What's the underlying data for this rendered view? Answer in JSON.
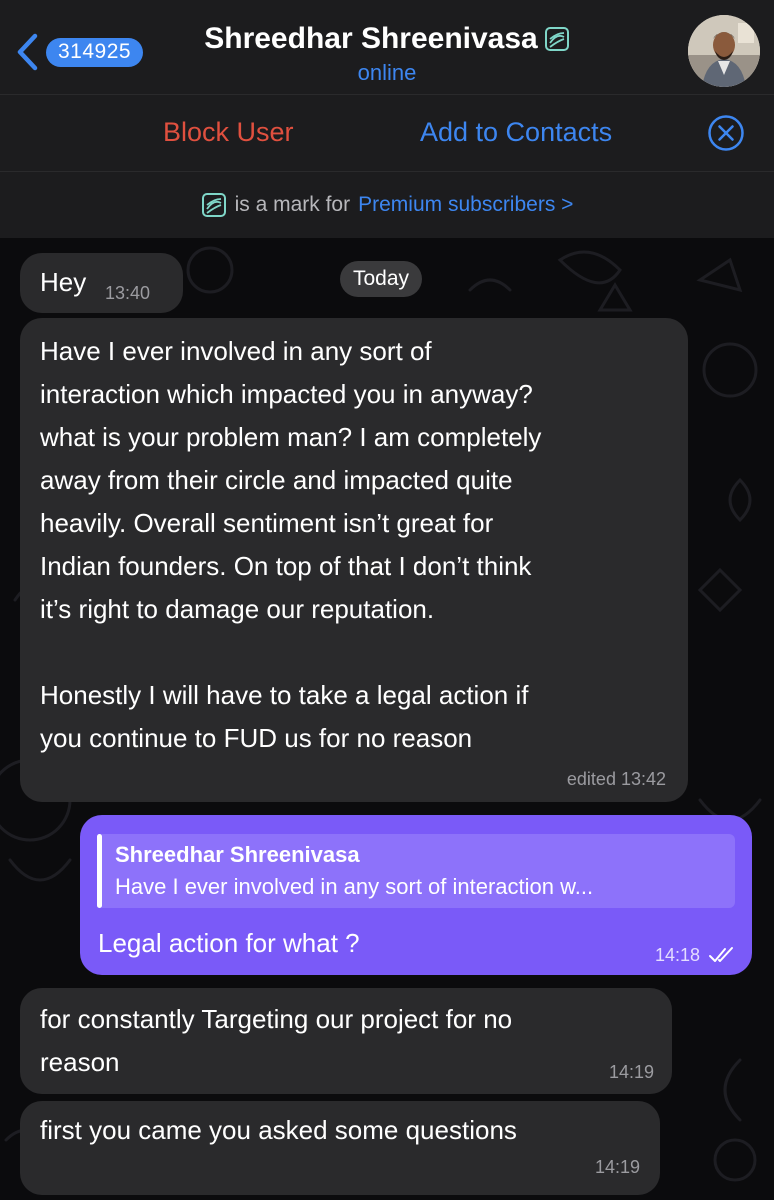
{
  "header": {
    "back_count": "314925",
    "name": "Shreedhar Shreenivasa",
    "status": "online"
  },
  "actions": {
    "block": "Block User",
    "add_contacts": "Add to Contacts"
  },
  "premium_notice": {
    "text": "is a mark for",
    "link": "Premium subscribers >"
  },
  "date_separator": "Today",
  "messages": [
    {
      "direction": "incoming",
      "text": "Hey",
      "time": "13:40"
    },
    {
      "direction": "incoming",
      "text": "Have I ever involved in any sort of\ninteraction which impacted you in anyway?\nwhat is your problem man? I am completely\naway from their circle and impacted quite\nheavily. Overall sentiment isn’t great for\nIndian founders. On top of that I don’t think\nit’s right to damage our reputation.\n\nHonestly I will have to take a legal action if\nyou continue to FUD us for no reason",
      "time": "edited 13:42"
    },
    {
      "direction": "outgoing",
      "reply_to": {
        "name": "Shreedhar Shreenivasa",
        "snippet": "Have I ever involved in any sort of interaction w..."
      },
      "text": "Legal action for what ?",
      "time": "14:18",
      "read": true
    },
    {
      "direction": "incoming",
      "text": "for constantly Targeting our project for no\nreason",
      "time": "14:19"
    },
    {
      "direction": "incoming",
      "text": "first you came you asked some questions",
      "time": "14:19"
    }
  ],
  "colors": {
    "accent": "#3d86f0",
    "danger": "#e0503f",
    "outgoing_bubble": "#7a5af8",
    "incoming_bubble": "#2a2a2c",
    "bar": "#1c1c1e"
  }
}
